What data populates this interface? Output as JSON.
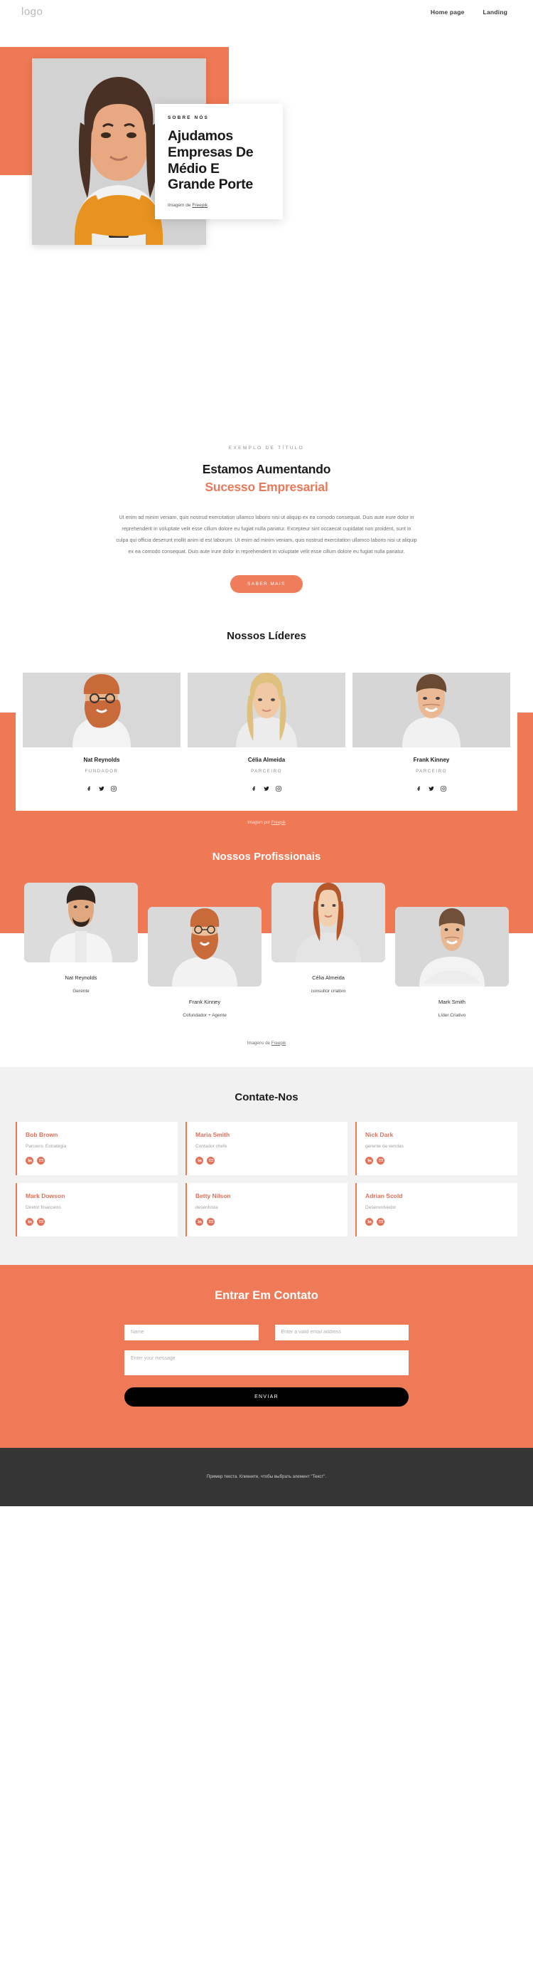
{
  "header": {
    "logo": "logo",
    "nav": [
      {
        "label": "Home page"
      },
      {
        "label": "Landing"
      }
    ]
  },
  "hero": {
    "kicker": "SOBRE NÓS",
    "title": "Ajudamos Empresas De Médio E Grande Porte",
    "credit_prefix": "Imagem de ",
    "credit_link": "Freepik"
  },
  "growth": {
    "eyebrow": "EXEMPLO DE TÍTULO",
    "title_line1": "Estamos Aumentando",
    "title_line2": "Sucesso Empresarial",
    "paragraph": "Ut enim ad minim veniam, quis nostrud exercitation ullamco laboris nisi ut aliquip ex ea comodo consequat. Duis aute irure dolor in reprehenderit in voluptate velit esse cillum dolore eu fugiat nulla pariatur. Excepteur sint occaecat cupidatat non proident, sunt in culpa qui officia deserunt mollit anim id est laborum. Ut enim ad minim veniam, quis nostrud exercitation ullamco laboris nisi ut aliquip ex ea comodo consequat. Duis aute irure dolor in reprehenderit in voluptate velit esse cillum dolore eu fugiat nulla pariatur.",
    "button": "SABER MAIS"
  },
  "leaders": {
    "title": "Nossos Líderes",
    "credit_prefix": "Imagem por ",
    "credit_link": "Freepik",
    "members": [
      {
        "name": "Nat Reynolds",
        "role": "FUNDADOR"
      },
      {
        "name": "Célia Almeida",
        "role": "PARCEIRO"
      },
      {
        "name": "Frank Kinney",
        "role": "PARCEIRO"
      }
    ]
  },
  "professionals": {
    "title": "Nossos Profissionais",
    "credit_prefix": "Imagens de ",
    "credit_link": "Freepik",
    "members": [
      {
        "name": "Nat Reynolds",
        "role": "Gerente"
      },
      {
        "name": "Frank Kinney",
        "role": "Cofundador + Agente"
      },
      {
        "name": "Célia Almeida",
        "role": "consultor criativo"
      },
      {
        "name": "Mark Smith",
        "role": "Líder Criativo"
      }
    ]
  },
  "contact": {
    "title": "Contate-Nos",
    "cards": [
      {
        "name": "Bob Brown",
        "role": "Parceiro, Estratégia"
      },
      {
        "name": "Maria Smith",
        "role": "Contador chefe"
      },
      {
        "name": "Nick Dark",
        "role": "gerente de vendas"
      },
      {
        "name": "Mark Dowson",
        "role": "Diretor financeiro"
      },
      {
        "name": "Betty Nilson",
        "role": "desenhista"
      },
      {
        "name": "Adrian Scold",
        "role": "Desenvolvedor"
      }
    ]
  },
  "form": {
    "title": "Entrar Em Contato",
    "name_placeholder": "Name",
    "email_placeholder": "Enter a valid email address",
    "message_placeholder": "Enter your message",
    "submit": "ENVIAR"
  },
  "footer": {
    "text": "Пример текста. Кликните, чтобы выбрать элемент \"Текст\"."
  },
  "colors": {
    "accent": "#ef7954",
    "dark": "#353535",
    "light_gray": "#f1f1f1"
  }
}
